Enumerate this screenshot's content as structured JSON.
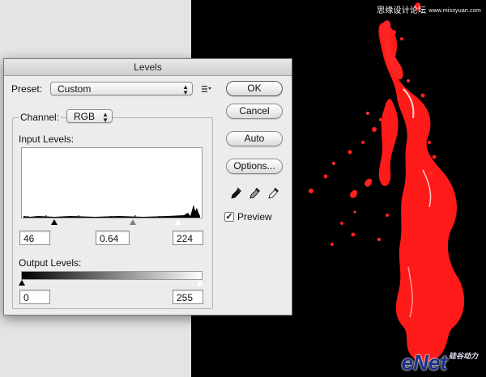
{
  "watermark": {
    "text": "思缘设计论坛",
    "url": "www.missyuan.com"
  },
  "brand": {
    "main": "eNet",
    "sub": "硅谷动力",
    "site": ".com.cn"
  },
  "dialog": {
    "title": "Levels",
    "preset_label": "Preset:",
    "preset_value": "Custom",
    "channel_label": "Channel:",
    "channel_value": "RGB",
    "input_levels_label": "Input Levels:",
    "input_black": "46",
    "input_gamma": "0.64",
    "input_white": "224",
    "output_levels_label": "Output Levels:",
    "output_black": "0",
    "output_white": "255",
    "buttons": {
      "ok": "OK",
      "cancel": "Cancel",
      "auto": "Auto",
      "options": "Options..."
    },
    "preview_label": "Preview",
    "preview_checked": true
  },
  "colors": {
    "splash": "#ff1a1a",
    "canvas": "#000000",
    "dialog_bg": "#ececec"
  },
  "icons": [
    "preset-options-menu-icon",
    "black-eyedropper-icon",
    "gray-eyedropper-icon",
    "white-eyedropper-icon",
    "checkmark-icon"
  ]
}
